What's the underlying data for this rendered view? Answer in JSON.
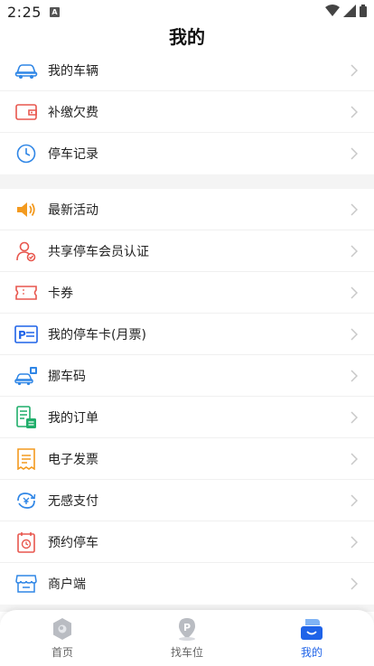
{
  "status_bar": {
    "time": "2:25",
    "notification_badge": "A"
  },
  "page_title": "我的",
  "groups": [
    {
      "items": [
        {
          "label": "我的车辆",
          "icon": "car-icon"
        },
        {
          "label": "补缴欠费",
          "icon": "wallet-icon"
        },
        {
          "label": "停车记录",
          "icon": "clock-icon"
        }
      ]
    },
    {
      "items": [
        {
          "label": "最新活动",
          "icon": "speaker-icon"
        },
        {
          "label": "共享停车会员认证",
          "icon": "member-verify-icon"
        },
        {
          "label": "卡券",
          "icon": "ticket-icon"
        },
        {
          "label": "我的停车卡(月票)",
          "icon": "parking-card-icon"
        },
        {
          "label": "挪车码",
          "icon": "move-car-icon"
        },
        {
          "label": "我的订单",
          "icon": "order-icon"
        },
        {
          "label": "电子发票",
          "icon": "invoice-icon"
        },
        {
          "label": "无感支付",
          "icon": "contactless-pay-icon"
        },
        {
          "label": "预约停车",
          "icon": "reserve-icon"
        },
        {
          "label": "商户端",
          "icon": "store-icon"
        }
      ]
    }
  ],
  "tabs": [
    {
      "label": "首页",
      "icon": "home-icon",
      "active": false
    },
    {
      "label": "找车位",
      "icon": "parking-locator-icon",
      "active": false
    },
    {
      "label": "我的",
      "icon": "profile-icon",
      "active": true
    }
  ],
  "colors": {
    "accent": "#1f63e8",
    "divider": "#f4f4f4",
    "chevron": "#c8c8c8"
  }
}
